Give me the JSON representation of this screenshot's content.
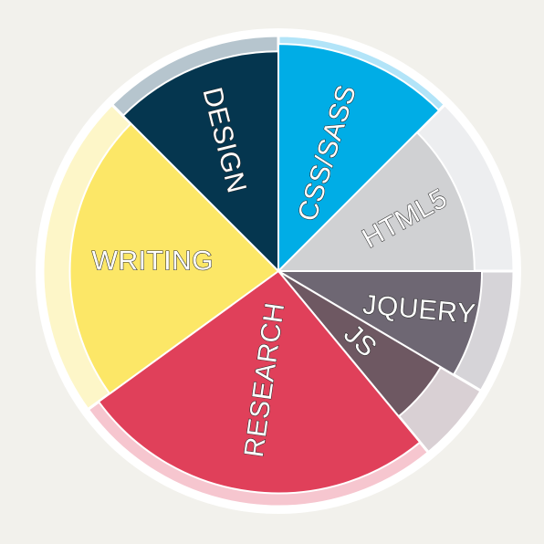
{
  "skills_wheel": {
    "slices": [
      {
        "label": "CSS/SASS",
        "value": 12.5,
        "depth": 0.915,
        "color": "#00ade6",
        "rim_color": "#b2e4f8"
      },
      {
        "label": "HTML5",
        "value": 12.5,
        "depth": 0.79,
        "color": "#d0d1d3",
        "rim_color": "#edeef0"
      },
      {
        "label": "JQUERY",
        "value": 8.5,
        "depth": 0.82,
        "color": "#6e6773",
        "rim_color": "#d6d4d8"
      },
      {
        "label": "JS",
        "value": 5.5,
        "depth": 0.76,
        "color": "#6e5862",
        "rim_color": "#d9d0d4"
      },
      {
        "label": "RESEARCH",
        "value": 26,
        "depth": 0.895,
        "color": "#e0405a",
        "rim_color": "#f6c6cf"
      },
      {
        "label": "WRITING",
        "value": 22.5,
        "depth": 0.84,
        "color": "#fce767",
        "rim_color": "#fdf6c8"
      },
      {
        "label": "DESIGN",
        "value": 12.5,
        "depth": 0.885,
        "color": "#05364f",
        "rim_color": "#b6c5ce"
      }
    ]
  }
}
